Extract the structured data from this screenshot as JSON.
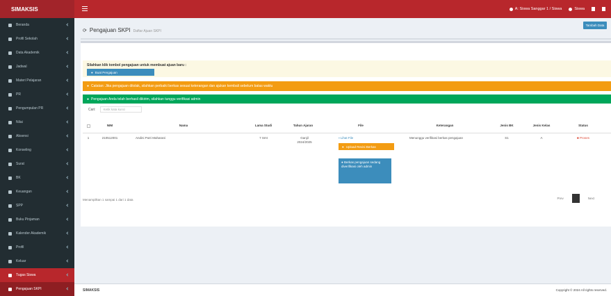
{
  "brand": "SIMAKSIS",
  "topbar": {
    "user_label": "A: Siswa Sanggar 1 / Siswa",
    "account_label": "Siswa",
    "colors": {
      "bar": "#b8272c",
      "brand": "#a2242a"
    }
  },
  "sidebar": {
    "items": [
      {
        "label": "Beranda",
        "icon": "dashboard-icon",
        "state": ""
      },
      {
        "label": "Profil Sekolah",
        "icon": "school-icon",
        "state": ""
      },
      {
        "label": "Data Akademik",
        "icon": "book-icon",
        "state": ""
      },
      {
        "label": "Jadwal",
        "icon": "calendar-icon",
        "state": ""
      },
      {
        "label": "Materi Pelajaran",
        "icon": "file-icon",
        "state": ""
      },
      {
        "label": "PR",
        "icon": "pencil-icon",
        "state": ""
      },
      {
        "label": "Pengumpulan PR",
        "icon": "upload-icon",
        "state": ""
      },
      {
        "label": "Nilai",
        "icon": "chart-icon",
        "state": ""
      },
      {
        "label": "Absensi",
        "icon": "check-icon",
        "state": ""
      },
      {
        "label": "Konseling",
        "icon": "chat-icon",
        "state": ""
      },
      {
        "label": "Surat",
        "icon": "mail-icon",
        "state": ""
      },
      {
        "label": "BK",
        "icon": "users-icon",
        "state": ""
      },
      {
        "label": "Keuangan",
        "icon": "money-icon",
        "state": ""
      },
      {
        "label": "SPP",
        "icon": "wallet-icon",
        "state": ""
      },
      {
        "label": "Buku Pinjaman",
        "icon": "book-icon",
        "state": ""
      },
      {
        "label": "Kalender Akademik",
        "icon": "calendar-icon",
        "state": ""
      },
      {
        "label": "Profil",
        "icon": "user-icon",
        "state": ""
      },
      {
        "label": "Keluar",
        "icon": "logout-icon",
        "state": ""
      },
      {
        "label": "Tugas Siswa",
        "icon": "tasks-icon",
        "state": "active"
      },
      {
        "label": "Pengajuan SKPI",
        "icon": "circle-icon",
        "state": "sub"
      }
    ]
  },
  "page": {
    "title": "Pengajuan SKPI",
    "subtitle": "Daftar Ajuan SKPI",
    "add_button": "Tambah Data"
  },
  "notice": {
    "text": "Silahkan klik tombol pengajuan untuk membuat ajuan baru :",
    "button": "Buat Pengajuan"
  },
  "alerts": {
    "warning": "Catatan: Jika pengajuan ditolak, silahkan perbaiki berkas sesuai keterangan dan ajukan kembali sebelum batas waktu",
    "success": "Pengajuan Anda telah berhasil dikirim, silahkan tunggu verifikasi admin"
  },
  "search": {
    "label": "Cari:",
    "placeholder": "Ketik kata kunci"
  },
  "table": {
    "headers": [
      "",
      "NIM",
      "Nama",
      "Lama Studi",
      "Tahun Ajaran",
      "File",
      "Keterangan",
      "Jenis BK",
      "Jenis Kelas",
      "Status"
    ],
    "rows": [
      {
        "no": "1",
        "nim": "210512001",
        "nama": "Andini Putri Maharani",
        "lama": "7 Smt",
        "tahun": "Ganjil 2024/2025",
        "file_link": "Lihat File",
        "orange_btn": "Upload Revisi Berkas",
        "blue_btn": "Berkas pengajuan sedang diverifikasi oleh admin",
        "keterangan": "Menunggu verifikasi berkas pengajuan",
        "jenis_bk": "S1",
        "jenis_kelas": "A",
        "status": "Proses"
      }
    ]
  },
  "table_info": "Menampilkan 1 sampai 1 dari 1 data",
  "pagination": {
    "prev": "Prev",
    "next": "Next"
  },
  "footer": {
    "left": "SIMAKSIS",
    "right": "Copyright © 2024 All rights reserved."
  }
}
